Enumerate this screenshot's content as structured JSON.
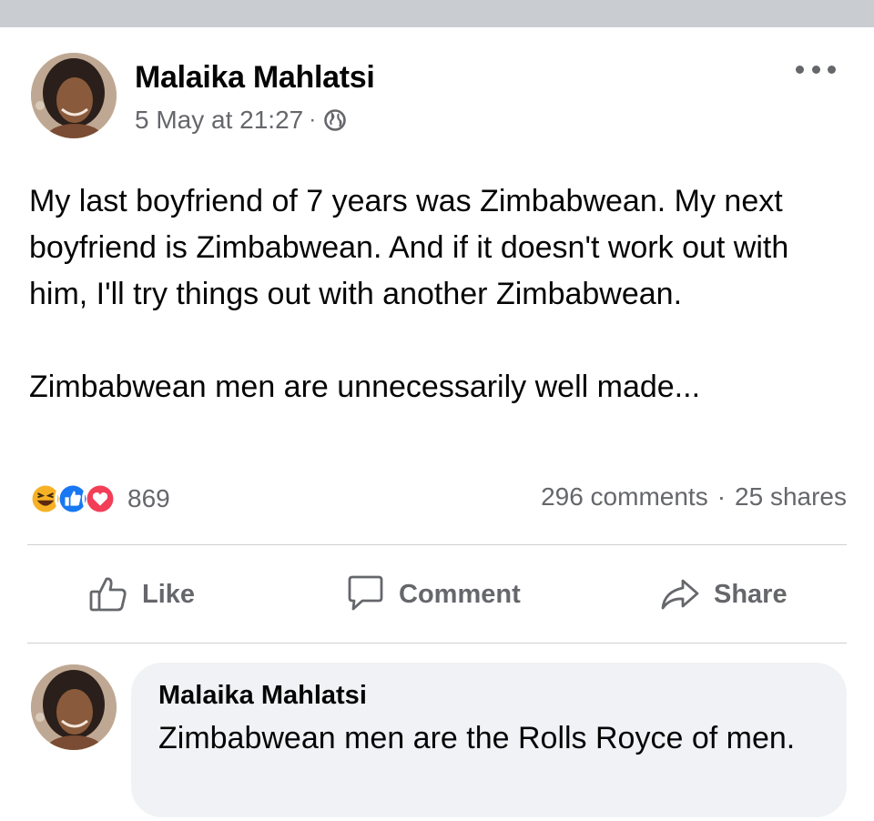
{
  "post": {
    "author": "Malaika Mahlatsi",
    "timestamp": "5 May at 21:27",
    "separator": "·",
    "privacy_icon": "globe-icon",
    "more_icon": "more-options-icon",
    "paragraphs": [
      "My last boyfriend of 7 years was Zimbabwean. My next boyfriend is Zimbabwean. And if it doesn't work out with him, I'll try things out with another Zimbabwean.",
      "Zimbabwean men are unnecessarily well made..."
    ],
    "reactions": {
      "icons": [
        "haha-icon",
        "like-reaction-icon",
        "love-icon"
      ],
      "count": "869"
    },
    "stats": {
      "comments": "296 comments",
      "separator": "·",
      "shares": "25 shares"
    },
    "actions": {
      "like": "Like",
      "comment": "Comment",
      "share": "Share"
    }
  },
  "comment": {
    "author": "Malaika Mahlatsi",
    "text": "Zimbabwean men are the Rolls Royce of men."
  },
  "colors": {
    "text_primary": "#050505",
    "text_secondary": "#65676b",
    "like_blue": "#1877f2",
    "love_red": "#f33e58",
    "haha_yellow": "#f7b125",
    "bubble_bg": "#f0f2f5",
    "divider": "#ced0d4"
  }
}
